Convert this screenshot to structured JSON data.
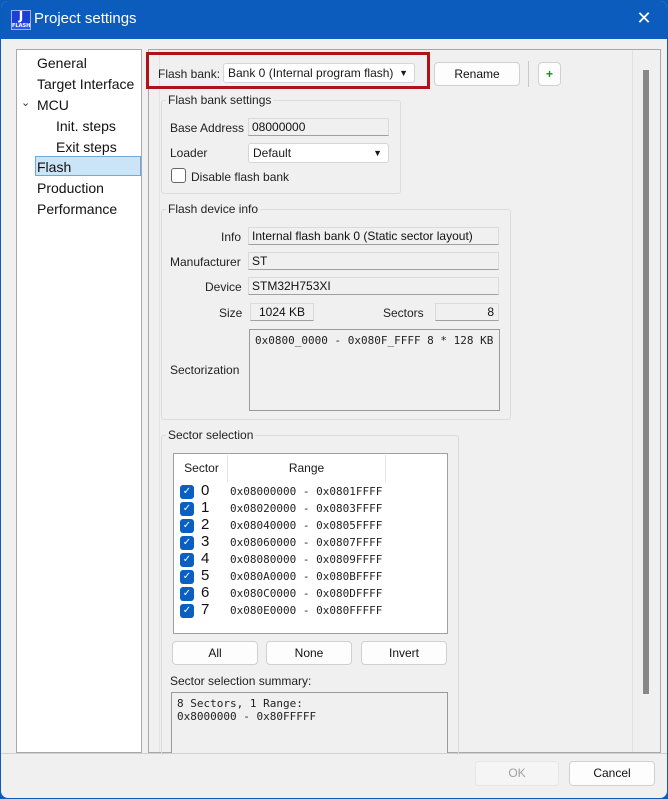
{
  "window": {
    "title": "Project settings",
    "app_icon_letter": "J",
    "app_icon_sub": "FLASH",
    "close_glyph": "✕"
  },
  "nav": {
    "items": [
      {
        "label": "General",
        "level": 0
      },
      {
        "label": "Target Interface",
        "level": 0
      },
      {
        "label": "MCU",
        "level": 0,
        "expanded": true
      },
      {
        "label": "Init. steps",
        "level": 1
      },
      {
        "label": "Exit steps",
        "level": 1
      },
      {
        "label": "Flash",
        "level": 0,
        "selected": true
      },
      {
        "label": "Production",
        "level": 0
      },
      {
        "label": "Performance",
        "level": 0
      }
    ],
    "expand_glyph": "⌄"
  },
  "flash_bank": {
    "label": "Flash bank:",
    "value": "Bank 0 (Internal program flash)",
    "rename_label": "Rename",
    "add_label": "+",
    "highlight_color": "#b0121b"
  },
  "bank_settings": {
    "title": "Flash bank settings",
    "base_address_label": "Base Address",
    "base_address_value": "08000000",
    "loader_label": "Loader",
    "loader_value": "Default",
    "disable_label": "Disable flash bank",
    "disable_checked": false
  },
  "device_info": {
    "title": "Flash device info",
    "info_label": "Info",
    "info_value": "Internal flash bank 0 (Static sector layout)",
    "manufacturer_label": "Manufacturer",
    "manufacturer_value": "ST",
    "device_label": "Device",
    "device_value": "STM32H753XI",
    "size_label": "Size",
    "size_value": "1024 KB",
    "sectors_label": "Sectors",
    "sectors_value": "8",
    "sectorization_label": "Sectorization",
    "sectorization_value": "0x0800_0000 - 0x080F_FFFF 8 * 128 KB"
  },
  "sector_selection": {
    "title": "Sector selection",
    "columns": [
      "Sector",
      "Range"
    ],
    "rows": [
      {
        "sector": "0",
        "range": "0x08000000 - 0x0801FFFF",
        "checked": true
      },
      {
        "sector": "1",
        "range": "0x08020000 - 0x0803FFFF",
        "checked": true
      },
      {
        "sector": "2",
        "range": "0x08040000 - 0x0805FFFF",
        "checked": true
      },
      {
        "sector": "3",
        "range": "0x08060000 - 0x0807FFFF",
        "checked": true
      },
      {
        "sector": "4",
        "range": "0x08080000 - 0x0809FFFF",
        "checked": true
      },
      {
        "sector": "5",
        "range": "0x080A0000 - 0x080BFFFF",
        "checked": true
      },
      {
        "sector": "6",
        "range": "0x080C0000 - 0x080DFFFF",
        "checked": true
      },
      {
        "sector": "7",
        "range": "0x080E0000 - 0x080FFFFF",
        "checked": true
      }
    ],
    "check_glyph": "✓",
    "all_label": "All",
    "none_label": "None",
    "invert_label": "Invert",
    "summary_label": "Sector selection summary:",
    "summary_value": "8 Sectors, 1 Range:\n0x8000000 - 0x80FFFFF"
  },
  "footer": {
    "ok_label": "OK",
    "cancel_label": "Cancel"
  }
}
